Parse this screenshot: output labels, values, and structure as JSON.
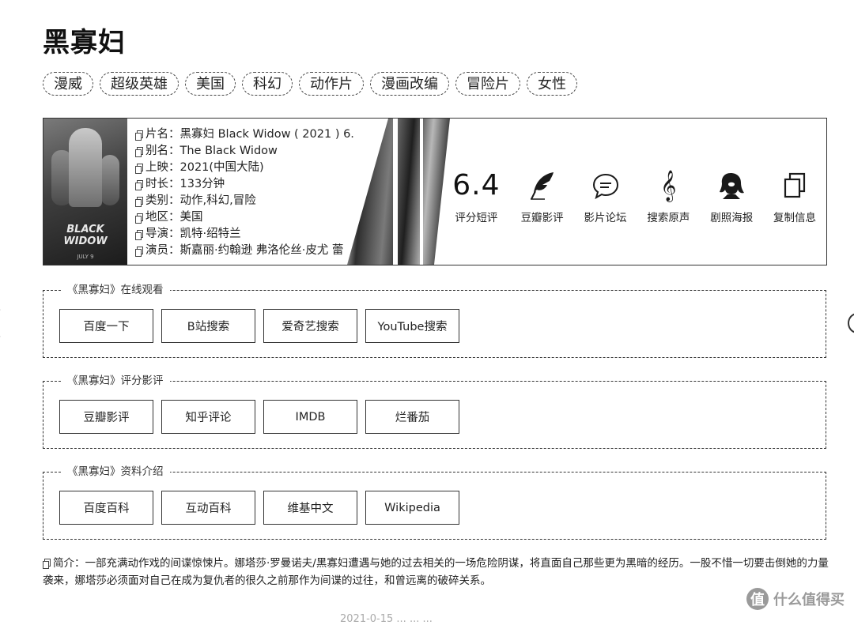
{
  "title": "黑寡妇",
  "tags": [
    "漫威",
    "超级英雄",
    "美国",
    "科幻",
    "动作片",
    "漫画改编",
    "冒险片",
    "女性"
  ],
  "poster": {
    "logo_text": "BLACK WIDOW",
    "date_text": "JULY 9"
  },
  "fields": [
    {
      "label": "片名",
      "value": "黑寡妇 Black Widow ( 2021 ) 6."
    },
    {
      "label": "别名",
      "value": "The Black Widow"
    },
    {
      "label": "上映",
      "value": "2021(中国大陆)"
    },
    {
      "label": "时长",
      "value": "133分钟"
    },
    {
      "label": "类别",
      "value": "动作,科幻,冒险"
    },
    {
      "label": "地区",
      "value": "美国"
    },
    {
      "label": "导演",
      "value": "凯特·绍特兰"
    },
    {
      "label": "演员",
      "value": "斯嘉丽·约翰逊 弗洛伦丝·皮尤 蕾"
    }
  ],
  "field_sep": "：",
  "actions": {
    "score_value": "6.4",
    "score_label": "评分短评",
    "items": [
      {
        "label": "豆瓣影评",
        "icon": "feather-icon"
      },
      {
        "label": "影片论坛",
        "icon": "speech-bubble-icon"
      },
      {
        "label": "搜索原声",
        "icon": "treble-clef-icon"
      },
      {
        "label": "剧照海报",
        "icon": "woman-silhouette-icon"
      },
      {
        "label": "复制信息",
        "icon": "copy-icon"
      }
    ]
  },
  "sections": [
    {
      "legend": "《黑寡妇》在线观看",
      "buttons": [
        "百度一下",
        "B站搜索",
        "爱奇艺搜索",
        "YouTube搜索"
      ]
    },
    {
      "legend": "《黑寡妇》评分影评",
      "buttons": [
        "豆瓣影评",
        "知乎评论",
        "IMDB",
        "烂番茄"
      ]
    },
    {
      "legend": "《黑寡妇》资料介绍",
      "buttons": [
        "百度百科",
        "互动百科",
        "维基中文",
        "Wikipedia"
      ]
    }
  ],
  "summary": {
    "label": "简介：",
    "text": "一部充满动作戏的间谍惊悚片。娜塔莎·罗曼诺夫/黑寡妇遭遇与她的过去相关的一场危险阴谋，将直面自己那些更为黑暗的经历。一股不惜一切要击倒她的力量袭来，娜塔莎必须面对自己在成为复仇者的很久之前那作为间谍的过往，和曾远离的破碎关系。"
  },
  "footer_faded": "2021-0-15 ... ... ...",
  "watermark": {
    "badge": "值",
    "text": "什么值得买"
  },
  "colors": {
    "border": "#333333",
    "text": "#222222",
    "watermark": "#9a9a9a"
  }
}
